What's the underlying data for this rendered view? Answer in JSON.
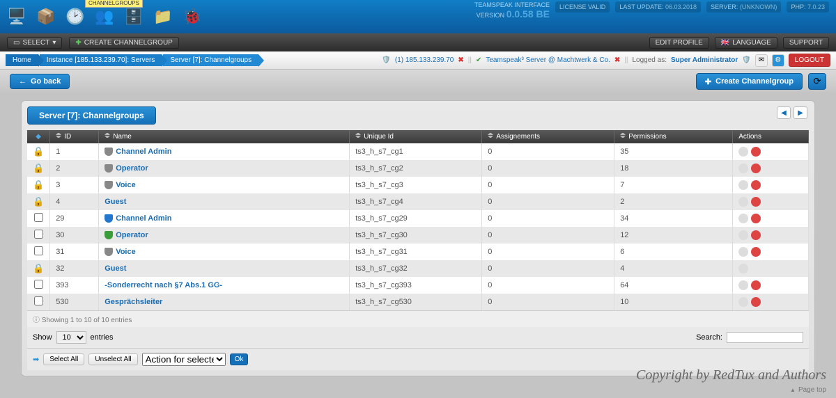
{
  "header": {
    "tab_label": "CHANNELGROUPS",
    "interface_title": "TEAMSPEAK INTERFACE",
    "version_label": "VERSION",
    "version": "0.0.58 BE",
    "license": "LICENSE VALID",
    "last_update_label": "LAST UPDATE:",
    "last_update_value": "06.03.2018",
    "server_label": "SERVER:",
    "server_value": "(UNKNOWN)",
    "php_label": "PHP:",
    "php_value": "7.0.23"
  },
  "main_icons": [
    "dashboard-icon",
    "cube-icon",
    "gauge-icon",
    "channelgroups-icon",
    "database-icon",
    "folder-icon",
    "bug-icon"
  ],
  "toolbar": {
    "select_label": "SELECT",
    "create_label": "CREATE CHANNELGROUP",
    "edit_profile": "EDIT PROFILE",
    "language": "LANGUAGE",
    "support": "SUPPORT"
  },
  "breadcrumb": {
    "items": [
      "Home",
      "Instance [185.133.239.70]: Servers",
      "Server [7]: Channelgroups"
    ]
  },
  "breadbar_right": {
    "instance": "(1) 185.133.239.70",
    "server_name": "Teamspeak³ Server @ Machtwerk & Co.",
    "logged_as_label": "Logged as:",
    "logged_user": "Super Administrator",
    "logout": "LOGOUT"
  },
  "subbar": {
    "go_back": "Go back",
    "create": "Create Channelgroup"
  },
  "panel": {
    "title": "Server [7]: Channelgroups",
    "columns": [
      "",
      "ID",
      "Name",
      "Unique Id",
      "Assignements",
      "Permissions",
      "Actions"
    ],
    "rows": [
      {
        "sel": "lock",
        "id": "1",
        "shield": "gray",
        "name": "Channel Admin",
        "uid": "ts3_h_s7_cg1",
        "assign": "0",
        "perm": "35",
        "del": true
      },
      {
        "sel": "lock",
        "id": "2",
        "shield": "gray",
        "name": "Operator",
        "uid": "ts3_h_s7_cg2",
        "assign": "0",
        "perm": "18",
        "del": true
      },
      {
        "sel": "lock",
        "id": "3",
        "shield": "gray",
        "name": "Voice",
        "uid": "ts3_h_s7_cg3",
        "assign": "0",
        "perm": "7",
        "del": true
      },
      {
        "sel": "lock",
        "id": "4",
        "shield": "",
        "name": "Guest",
        "uid": "ts3_h_s7_cg4",
        "assign": "0",
        "perm": "2",
        "del": true
      },
      {
        "sel": "check",
        "id": "29",
        "shield": "blue",
        "name": "Channel Admin",
        "uid": "ts3_h_s7_cg29",
        "assign": "0",
        "perm": "34",
        "del": true
      },
      {
        "sel": "check",
        "id": "30",
        "shield": "green",
        "name": "Operator",
        "uid": "ts3_h_s7_cg30",
        "assign": "0",
        "perm": "12",
        "del": true
      },
      {
        "sel": "check",
        "id": "31",
        "shield": "gray",
        "name": "Voice",
        "uid": "ts3_h_s7_cg31",
        "assign": "0",
        "perm": "6",
        "del": true
      },
      {
        "sel": "lock",
        "id": "32",
        "shield": "",
        "name": "Guest",
        "uid": "ts3_h_s7_cg32",
        "assign": "0",
        "perm": "4",
        "del": false
      },
      {
        "sel": "check",
        "id": "393",
        "shield": "",
        "name": "-Sonderrecht nach §7 Abs.1 GG-",
        "uid": "ts3_h_s7_cg393",
        "assign": "0",
        "perm": "64",
        "del": true
      },
      {
        "sel": "check",
        "id": "530",
        "shield": "",
        "name": "Gesprächsleiter",
        "uid": "ts3_h_s7_cg530",
        "assign": "0",
        "perm": "10",
        "del": true
      }
    ],
    "info": "Showing 1 to 10 of 10 entries",
    "show_label": "Show",
    "show_value": "10",
    "entries_label": "entries",
    "search_label": "Search:",
    "select_all": "Select All",
    "unselect_all": "Unselect All",
    "action_for_selected": "Action for selected...",
    "ok": "Ok"
  },
  "footer": {
    "copyright": "Copyright by RedTux and Authors",
    "page_top": "Page top"
  }
}
